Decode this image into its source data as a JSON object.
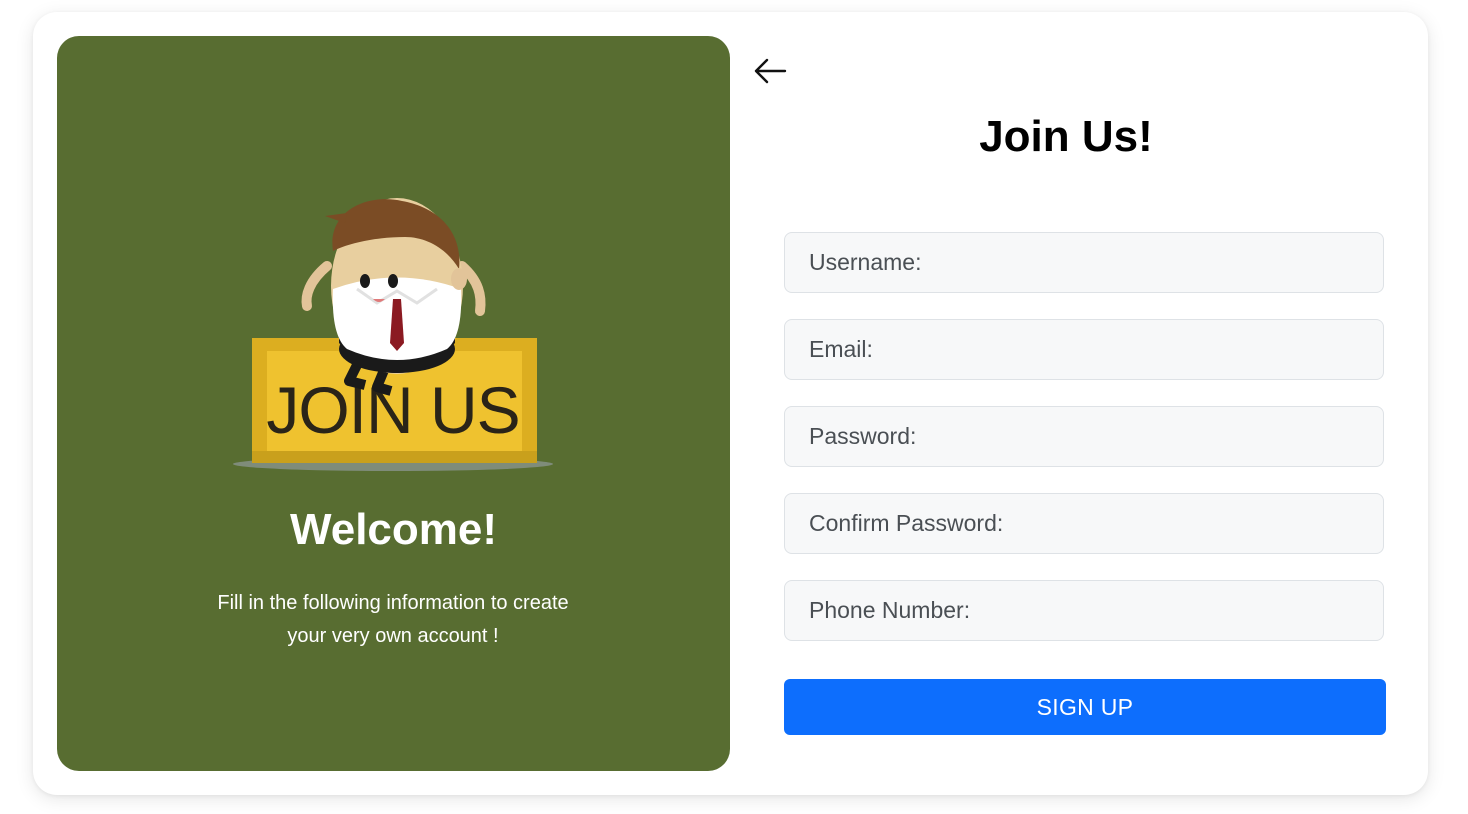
{
  "welcome_panel": {
    "sign_text": "JOIN US",
    "title": "Welcome!",
    "message_line1": "Fill in the following information to create",
    "message_line2": "your very own account !",
    "background_color": "#586d31"
  },
  "form": {
    "back_icon": "arrow-left-icon",
    "title": "Join Us!",
    "fields": {
      "username_placeholder": "Username:",
      "email_placeholder": "Email:",
      "password_placeholder": "Password:",
      "confirm_password_placeholder": "Confirm Password:",
      "phone_placeholder": "Phone Number:"
    },
    "submit_label": "SIGN UP",
    "accent_color": "#0d6efd"
  }
}
